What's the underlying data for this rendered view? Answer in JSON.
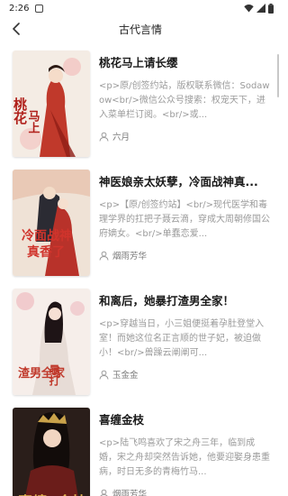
{
  "status": {
    "time": "2:26"
  },
  "nav": {
    "title": "古代言情"
  },
  "books": [
    {
      "title": "桃花马上请长缨",
      "desc": "<p>原/创签约站，版权联系微信：Sodawow<br/>微信公众号搜索：权宠天下，进入菜单栏订阅。<br/>或...",
      "author": "六月",
      "cover_text": "桃花马上"
    },
    {
      "title": "神医娘亲太妖孽，冷面战神真...",
      "desc": "<p>【原/创签约站】<br/>现代医学和毒理学界的扛把子聂云滴，穿成大周朝修国公府嫡女。<br/>单蠢恋爱...",
      "author": "烟雨芳华",
      "cover_text": "冷面战神 真香了"
    },
    {
      "title": "和离后，她暴打渣男全家！",
      "desc": "<p>穿越当日，小三姐便挺着孕肚登堂入室！而她这位名正言顺的世子妃，被迫做小！<br/>兽躁云阐阐可...",
      "author": "玉金金",
      "cover_text": "暴打 渣男全家"
    },
    {
      "title": "喜缠金枝",
      "desc": "<p>陆飞鸣喜欢了宋之舟三年，临到成婚，宋之舟却突然告诉她，他要迎娶身患重病，时日无多的青梅竹马...",
      "author": "烟雨芳华",
      "cover_text": "喜缠金枝"
    }
  ],
  "colors": {
    "accent": "#c0392b",
    "desc": "#9a9a9a",
    "author": "#777777"
  }
}
